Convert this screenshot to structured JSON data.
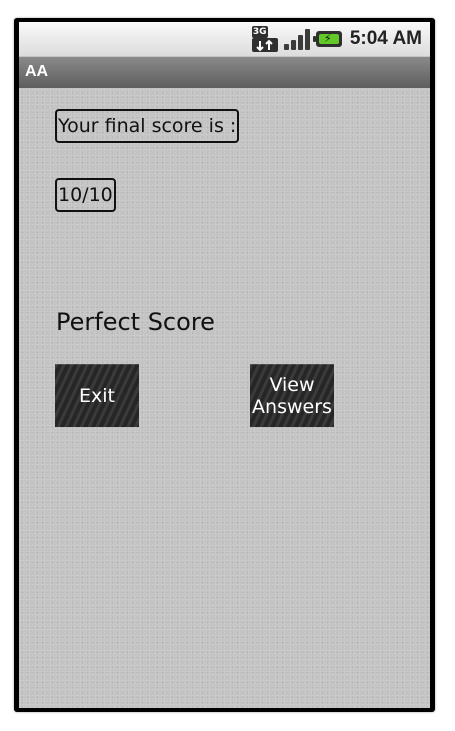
{
  "status_bar": {
    "network": "3G",
    "time": "5:04 AM",
    "icons": [
      "network-3g-icon",
      "signal-icon",
      "battery-charging-icon"
    ]
  },
  "title_bar": {
    "title": "AA"
  },
  "result": {
    "score_label": "Your final score is :",
    "score_value": "10/10",
    "message": "Perfect Score"
  },
  "buttons": {
    "exit": "Exit",
    "view_line1": "View",
    "view_line2": "Answers"
  }
}
